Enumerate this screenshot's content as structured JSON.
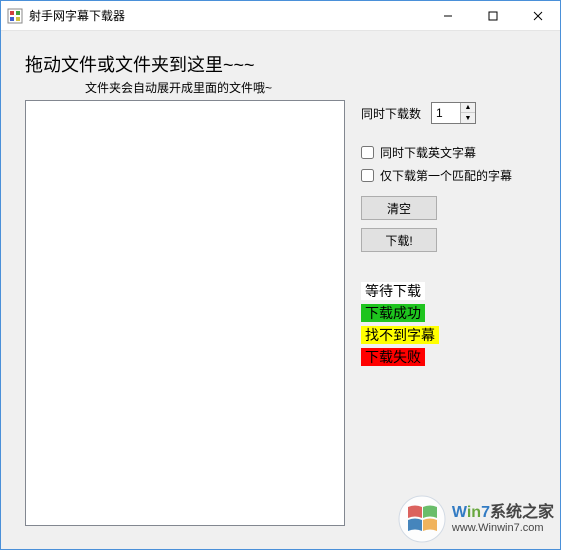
{
  "window": {
    "title": "射手网字幕下载器"
  },
  "prompt": {
    "heading": "拖动文件或文件夹到这里~~~",
    "sub": "文件夹会自动展开成里面的文件哦~"
  },
  "side": {
    "concurrent_label": "同时下载数",
    "concurrent_value": "1",
    "checkbox_english": "同时下载英文字幕",
    "checkbox_firstmatch": "仅下载第一个匹配的字幕",
    "btn_clear": "清空",
    "btn_download": "下载!"
  },
  "legend": {
    "wait": "等待下载",
    "success": "下载成功",
    "notfound": "找不到字幕",
    "fail": "下载失败"
  },
  "watermark": {
    "brand_w": "W",
    "brand_in": "in",
    "brand_7": "7",
    "brand_rest": "系统之家",
    "url": "www.Winwin7.com"
  }
}
